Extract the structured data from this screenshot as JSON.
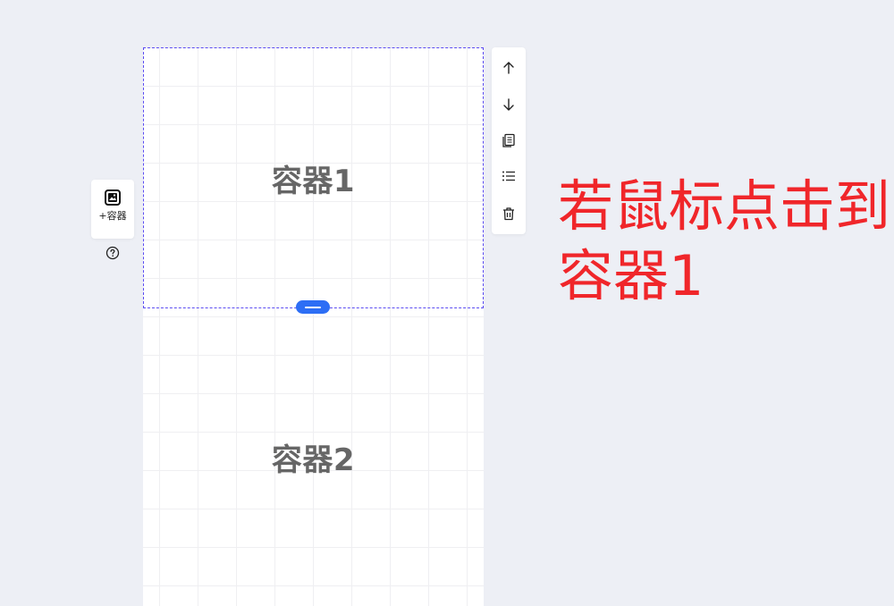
{
  "left_toolbar": {
    "add_container_label": "+容器",
    "add_icon": "image-add-icon",
    "help_icon": "question-circle-icon"
  },
  "canvas": {
    "containers": [
      {
        "label": "容器1",
        "selected": true
      },
      {
        "label": "容器2",
        "selected": false
      }
    ],
    "resize_handle_icon": "drag-handle-icon",
    "colors": {
      "selection_outline": "#5b4cf2",
      "handle": "#2d6ef5",
      "title": "#666666"
    }
  },
  "right_toolbar": {
    "buttons": [
      {
        "icon": "arrow-up-icon"
      },
      {
        "icon": "arrow-down-icon"
      },
      {
        "icon": "copy-icon"
      },
      {
        "icon": "list-icon"
      },
      {
        "icon": "trash-icon"
      }
    ]
  },
  "annotation": {
    "line1": "若鼠标点击到",
    "line2": "容器1",
    "color": "#f0262a"
  }
}
